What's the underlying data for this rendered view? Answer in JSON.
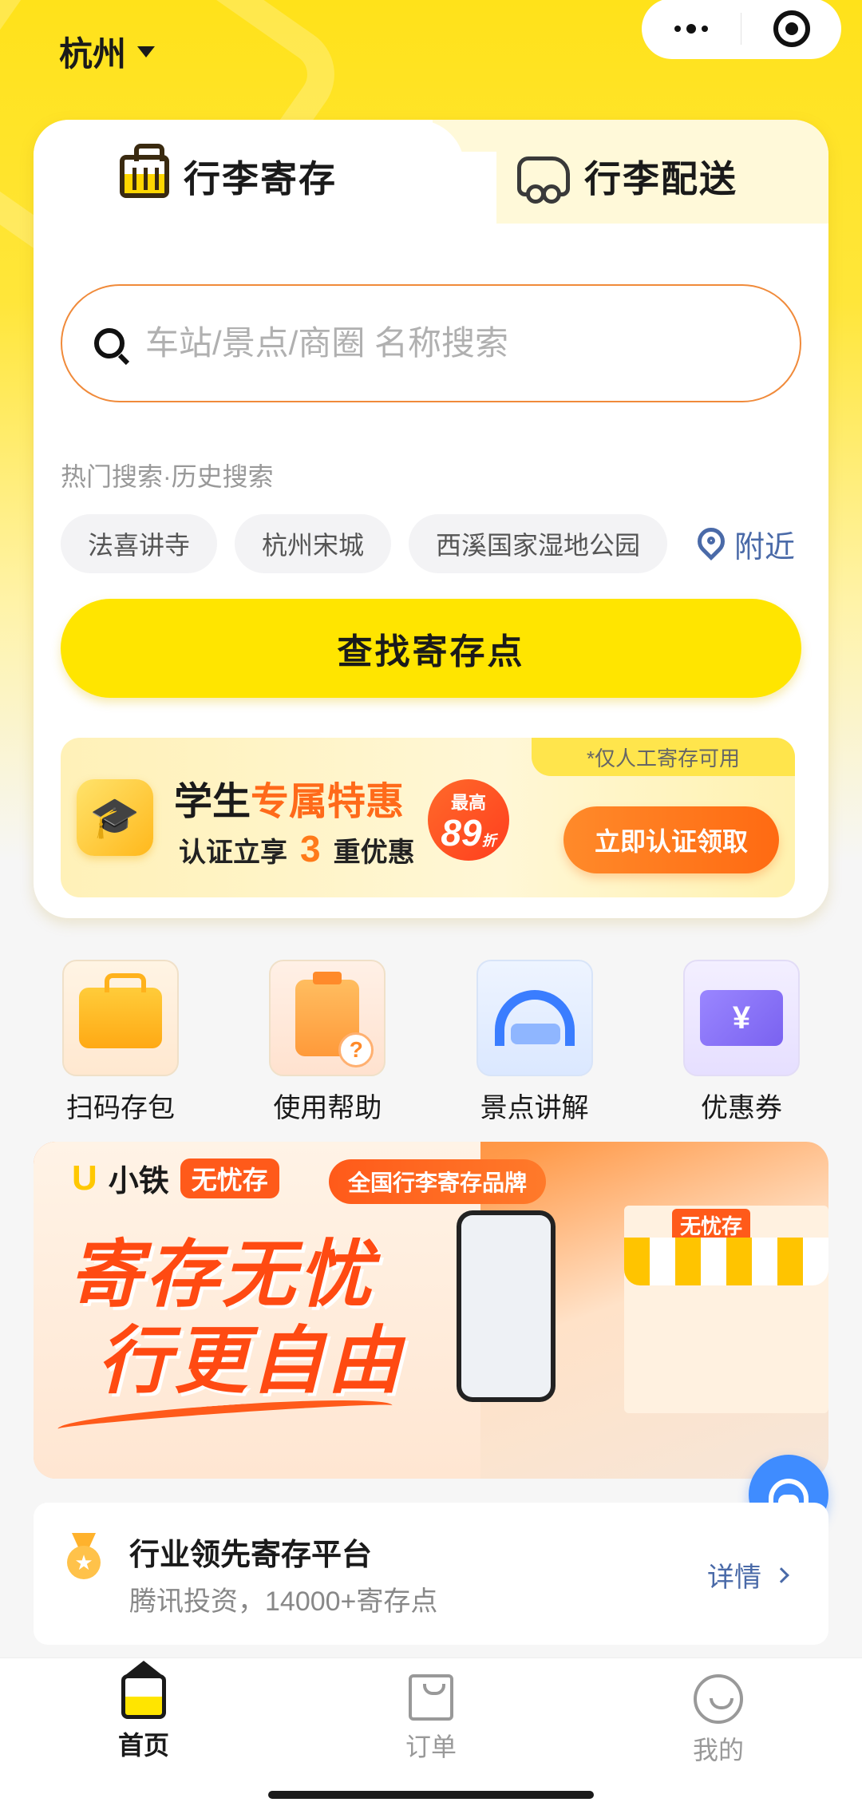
{
  "header": {
    "city": "杭州"
  },
  "tabs": [
    {
      "label": "行李寄存",
      "icon": "luggage-icon",
      "active": true
    },
    {
      "label": "行李配送",
      "icon": "delivery-truck-icon",
      "active": false
    }
  ],
  "search": {
    "placeholder": "车站/景点/商圈 名称搜索"
  },
  "hot_search": {
    "title": "热门搜索·历史搜索",
    "chips": [
      "法喜讲寺",
      "杭州宋城",
      "西溪国家湿地公园"
    ],
    "nearby_label": "附近"
  },
  "find_button": "查找寄存点",
  "promo": {
    "note": "*仅人工寄存可用",
    "title_plain": "学生",
    "title_highlight": "专属特惠",
    "sub_prefix": "认证立享",
    "sub_number": "3",
    "sub_suffix": "重优惠",
    "badge_top": "最高",
    "badge_value": "89",
    "badge_unit": "折",
    "button": "立即认证领取"
  },
  "quick_actions": [
    {
      "label": "扫码存包",
      "icon": "scan-bag-icon"
    },
    {
      "label": "使用帮助",
      "icon": "help-clipboard-icon"
    },
    {
      "label": "景点讲解",
      "icon": "headset-icon"
    },
    {
      "label": "优惠券",
      "icon": "coupon-icon"
    }
  ],
  "banner": {
    "brand": "小铁",
    "brand_tag": "无忧存",
    "pill": "全国行李寄存品牌",
    "slogan_line1": "寄存无忧",
    "slogan_line2": "行更自由",
    "store_sign": "无忧存"
  },
  "info": {
    "title": "行业领先寄存平台",
    "subtitle": "腾讯投资，14000+寄存点",
    "more": "详情"
  },
  "tabbar": [
    {
      "label": "首页",
      "icon": "home-icon",
      "active": true
    },
    {
      "label": "订单",
      "icon": "order-icon",
      "active": false
    },
    {
      "label": "我的",
      "icon": "profile-icon",
      "active": false
    }
  ],
  "colors": {
    "brand_yellow": "#ffe500",
    "accent_orange": "#ff6a1a",
    "link_blue": "#4a6aa8"
  }
}
